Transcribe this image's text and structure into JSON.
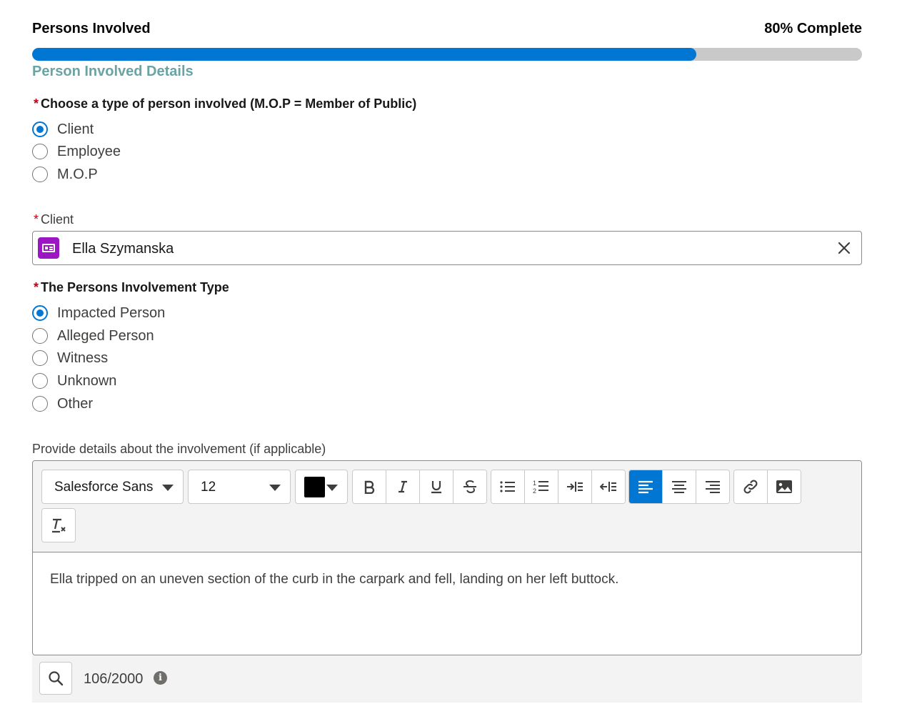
{
  "header": {
    "title": "Persons Involved",
    "progress_label": "80% Complete",
    "progress_value": 0.8
  },
  "section": {
    "title": "Person Involved Details"
  },
  "required_marker": "*",
  "person_type": {
    "label": "Choose a type of person involved (M.O.P = Member of Public)",
    "options": [
      "Client",
      "Employee",
      "M.O.P"
    ],
    "selected": "Client"
  },
  "client_field": {
    "label": "Client",
    "value": "Ella Szymanska",
    "icon": "contact-card-icon",
    "icon_color": "#9c17c4"
  },
  "involvement_type": {
    "label": "The Persons Involvement Type",
    "options": [
      "Impacted Person",
      "Alleged Person",
      "Witness",
      "Unknown",
      "Other"
    ],
    "selected": "Impacted Person"
  },
  "details": {
    "label": "Provide details about the involvement (if applicable)",
    "toolbar": {
      "font_family": "Salesforce Sans",
      "font_size": "12",
      "text_color": "#000000",
      "active_align": "align-left"
    },
    "body": "Ella tripped on an uneven section of the curb in the carpark and fell, landing on her left buttock.",
    "char_count": "106/2000",
    "info_icon": "i"
  },
  "colors": {
    "accent": "#0176d3",
    "required": "#ba0517",
    "section_title": "#6aa3a3"
  }
}
